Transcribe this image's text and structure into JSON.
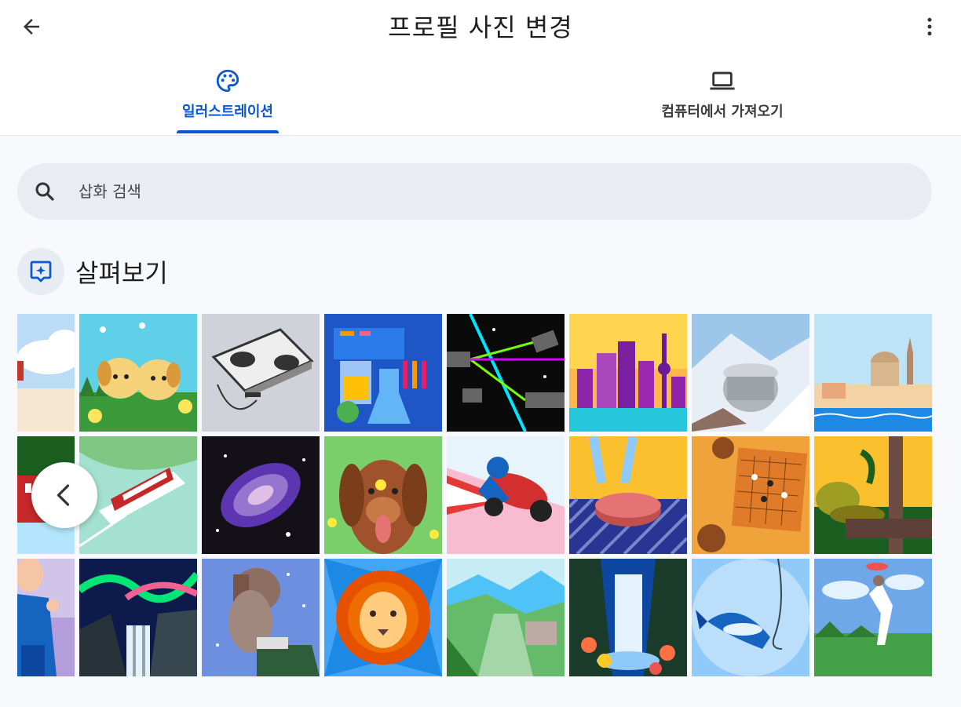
{
  "header": {
    "title": "프로필 사진 변경",
    "back_icon": "arrow-left-icon",
    "menu_icon": "more-vertical-icon"
  },
  "tabs": [
    {
      "label": "일러스트레이션",
      "icon": "palette-icon",
      "active": true
    },
    {
      "label": "컴퓨터에서 가져오기",
      "icon": "laptop-icon",
      "active": false
    }
  ],
  "search": {
    "placeholder": "삽화 검색",
    "value": "",
    "icon": "search-icon"
  },
  "section": {
    "title": "살펴보기",
    "icon": "explore-sparkle-icon"
  },
  "gallery": {
    "rows": [
      [
        "clouds-partial",
        "puppies",
        "dj-turntable",
        "science-lab",
        "laser-space",
        "purple-city",
        "mountain-building",
        "coastal-town"
      ],
      [
        "village-partial",
        "ferry-ship",
        "purple-galaxy",
        "golden-dog",
        "motorcycle-racer",
        "grilled-steak",
        "go-board",
        "jungle-python"
      ],
      [
        "musician-partial",
        "aurora-waterfall",
        "fur-hat-person",
        "lion-face",
        "valley-river",
        "waterfall-flowers",
        "fish-hook",
        "dog-frisbee"
      ]
    ],
    "prev_icon": "chevron-left-icon"
  },
  "colors": {
    "accent": "#0b57d0",
    "search_bg": "#e9ecf2",
    "page_bg": "#f8f9fc"
  }
}
